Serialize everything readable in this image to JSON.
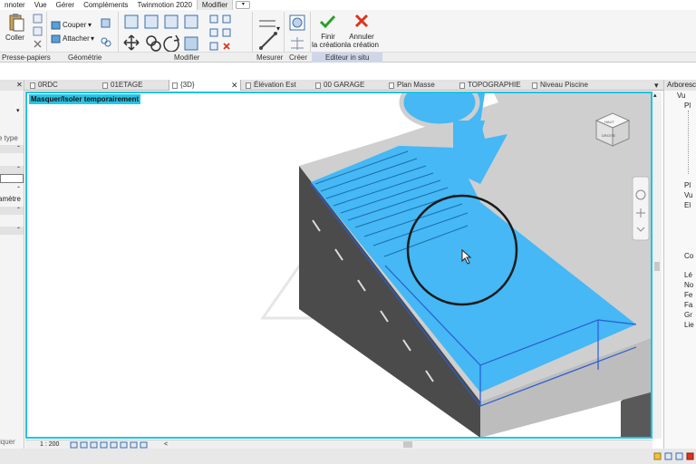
{
  "menu": {
    "items": [
      {
        "label": "nnoter"
      },
      {
        "label": "Vue"
      },
      {
        "label": "Gérer"
      },
      {
        "label": "Compléments"
      },
      {
        "label": "Twinmotion 2020"
      },
      {
        "label": "Modifier"
      }
    ],
    "active_index": 5
  },
  "ribbon": {
    "paste_label": "Coller",
    "cut_label": "Couper",
    "attach_label": "Attacher",
    "measure_label": "Mesurer",
    "create_label": "Créer",
    "finish_label_1": "Finir",
    "finish_label_2": "la création",
    "cancel_label_1": "Annuler",
    "cancel_label_2": "la création",
    "groups": {
      "clipboard": "Presse-papiers",
      "geometry": "Géométrie",
      "modify": "Modifier",
      "measure": "Mesurer",
      "create": "Créer",
      "inplace_editor": "Editeur in situ"
    }
  },
  "tabs": [
    {
      "label": "0RDC"
    },
    {
      "label": "01ETAGE"
    },
    {
      "label": "{3D}"
    },
    {
      "label": "Élévation Est"
    },
    {
      "label": "00 GARAGE"
    },
    {
      "label": "Plan Masse"
    },
    {
      "label": "TOPOGRAPHIE"
    },
    {
      "label": "Niveau Piscine"
    }
  ],
  "properties": {
    "type_label": "e type",
    "param_label": "amètre",
    "apply_label": "iquer"
  },
  "viewport": {
    "mode_banner": "Masquer/Isoler temporairement"
  },
  "viewcube": {
    "top": "HAUT",
    "front": "DROITE"
  },
  "statusbar": {
    "scale": "1 : 200"
  },
  "browser": {
    "title": "Arboresce",
    "items": [
      "Vu",
      "Pl",
      "Pl",
      "Vu",
      "El",
      "Co",
      "Lé",
      "No",
      "Fe",
      "Fa",
      "Gr",
      "Lie"
    ]
  },
  "colors": {
    "accent": "#1fc3e4",
    "water": "#45b8f5",
    "finish_green": "#2aa02a",
    "cancel_red": "#d9351c"
  }
}
